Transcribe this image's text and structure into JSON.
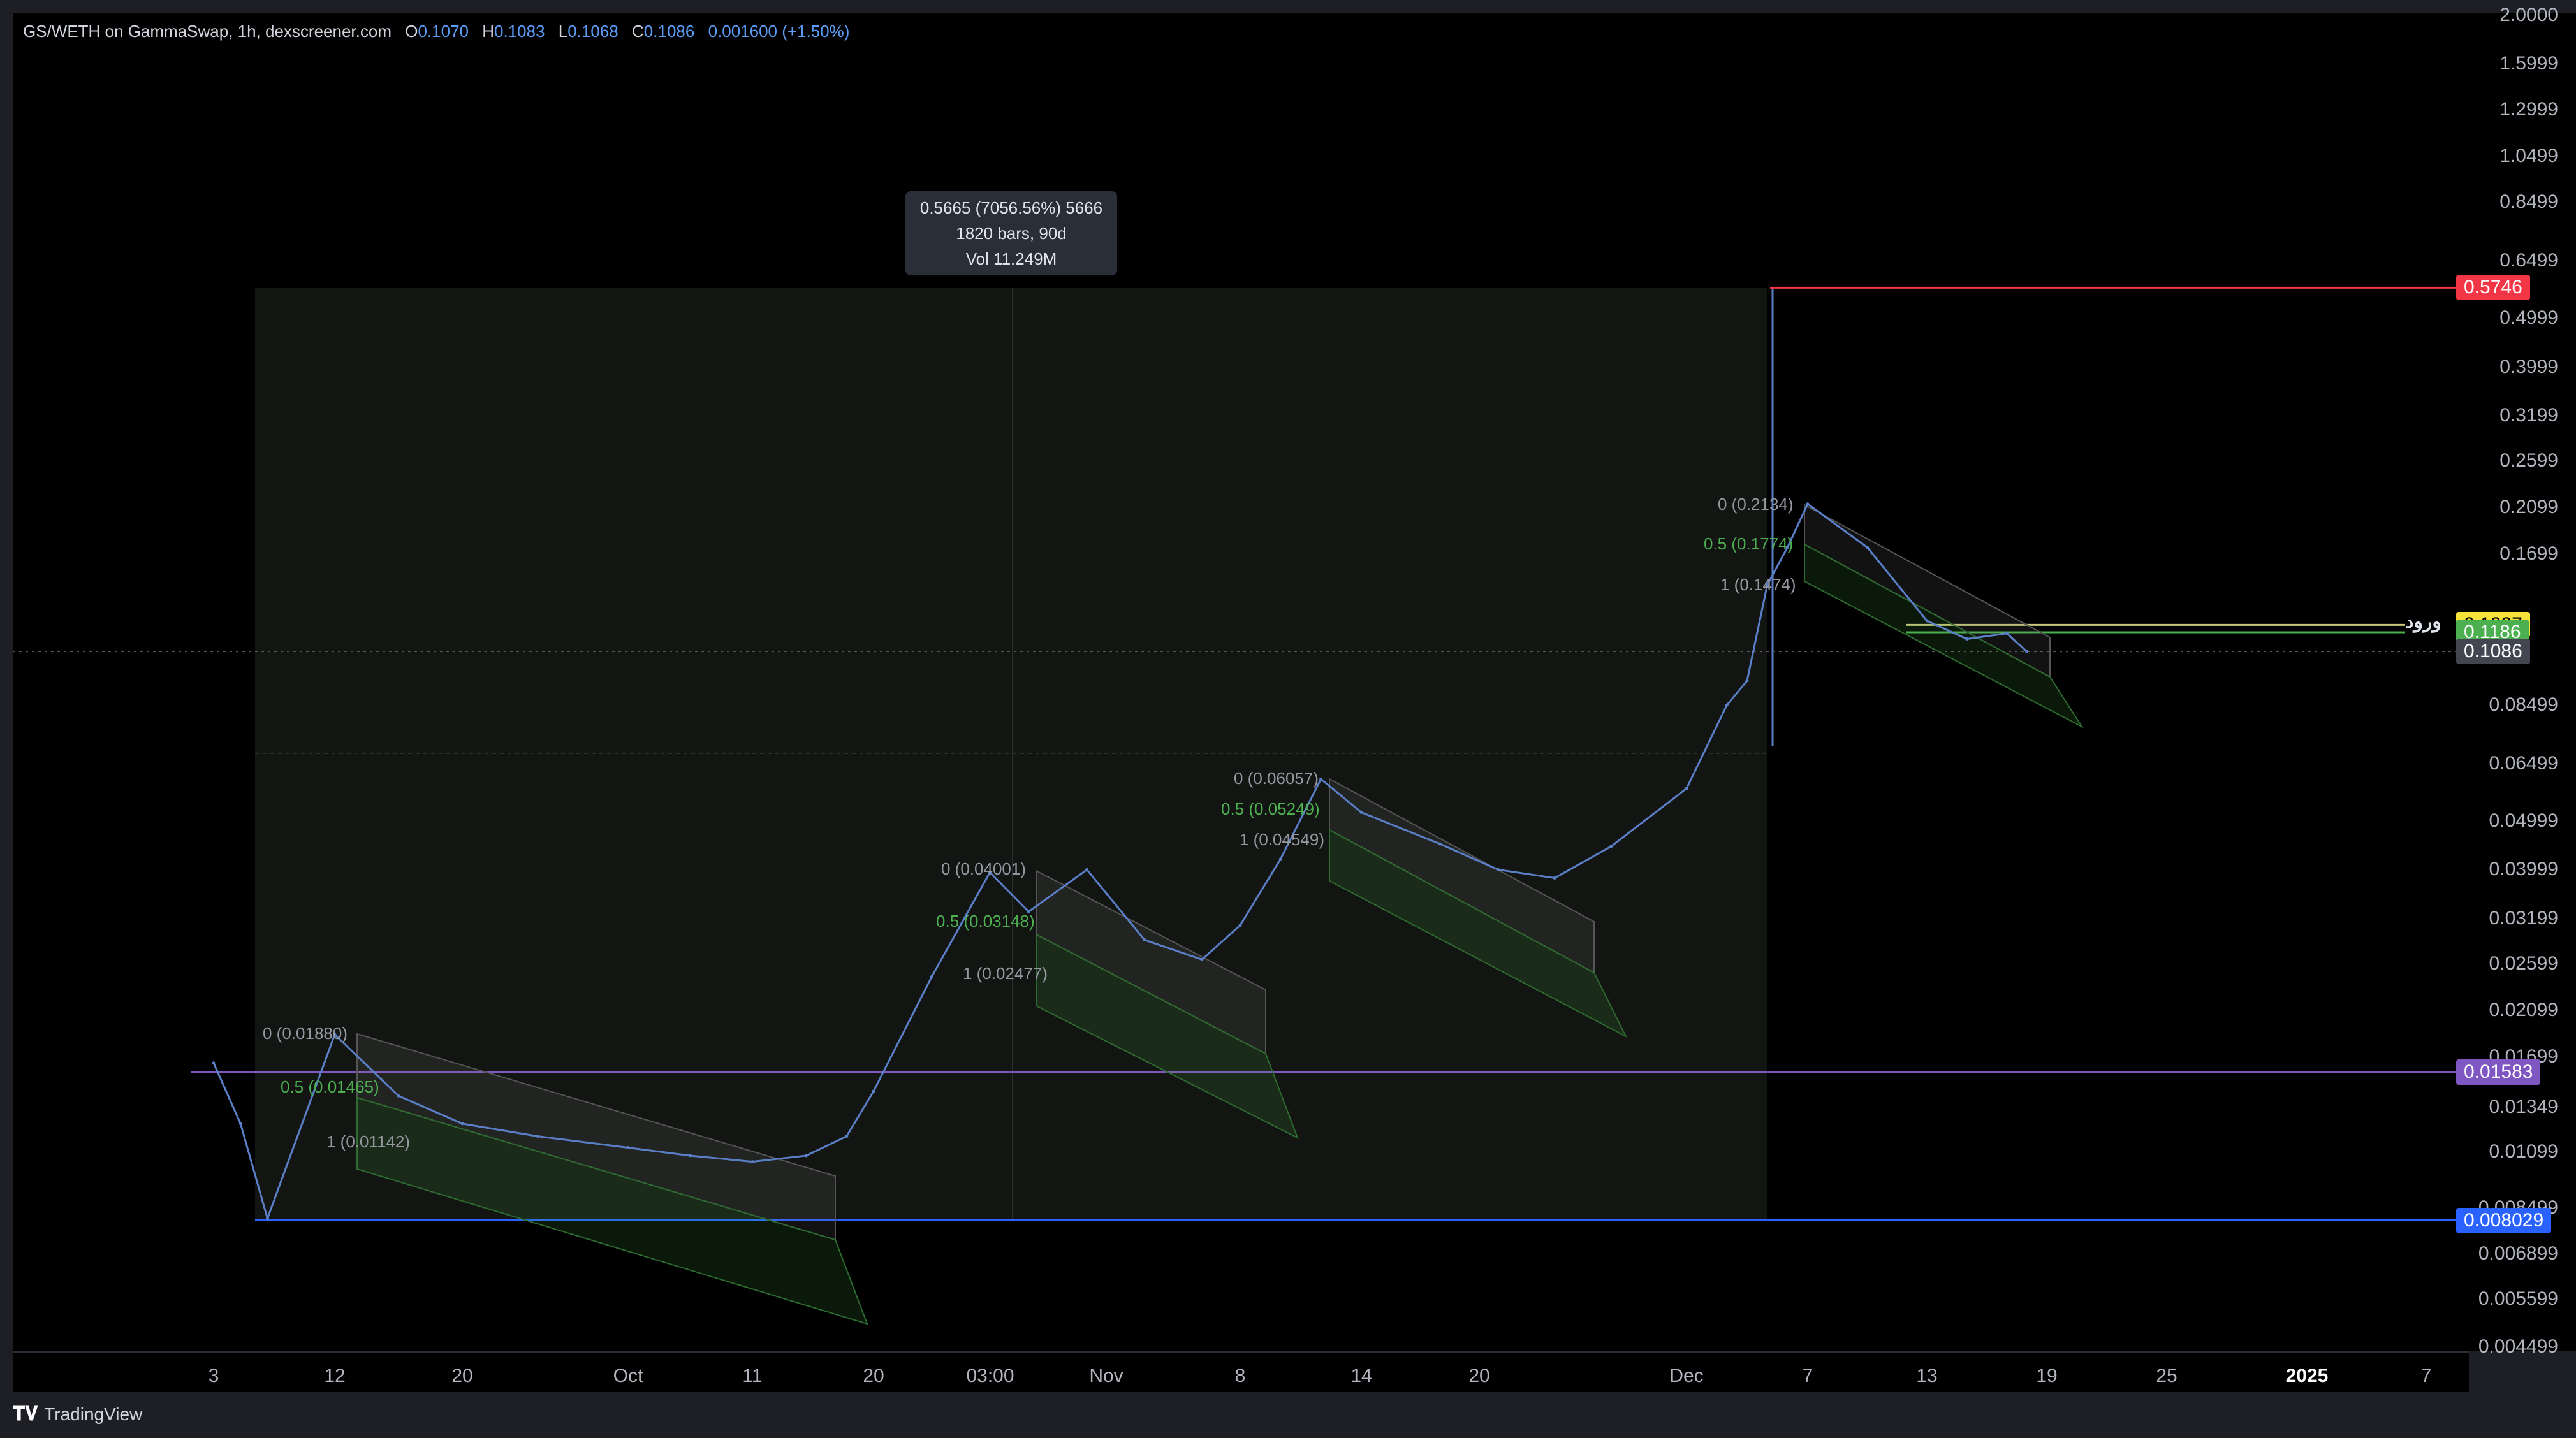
{
  "header": {
    "symbol": "GS/WETH on GammaSwap, 1h, dexscreener.com",
    "o_label": "O",
    "o_value": "0.1070",
    "h_label": "H",
    "h_value": "0.1083",
    "l_label": "L",
    "l_value": "0.1068",
    "c_label": "C",
    "c_value": "0.1086",
    "change": "0.001600 (+1.50%)"
  },
  "measure": {
    "line1": "0.5665 (7056.56%) 5666",
    "line2": "1820 bars, 90d",
    "line3": "Vol 11.249M"
  },
  "price_labels": [
    "2.0000",
    "1.5999",
    "1.2999",
    "1.0499",
    "0.8499",
    "0.6499",
    "0.4999",
    "0.3999",
    "0.3199",
    "0.2599",
    "0.2099",
    "0.1699",
    "0.08499",
    "0.06499",
    "0.04999",
    "0.03999",
    "0.03199",
    "0.02599",
    "0.02099",
    "0.01699",
    "0.01349",
    "0.01099",
    "0.008499",
    "0.006899",
    "0.005599",
    "0.004499"
  ],
  "price_tags": [
    {
      "text": "0.5746",
      "color": "#f23645"
    },
    {
      "text": "0.1227",
      "color": "#f5e33a"
    },
    {
      "text": "0.1186",
      "color": "#4caf50"
    },
    {
      "text": "0.1086",
      "color": "#434651"
    },
    {
      "text": "0.01583",
      "color": "#7e57c2"
    },
    {
      "text": "0.008029",
      "color": "#2962ff"
    }
  ],
  "time_labels": [
    "3",
    "12",
    "20",
    "Oct",
    "11",
    "20",
    "03:00",
    "Nov",
    "8",
    "14",
    "20",
    "Dec",
    "7",
    "13",
    "19",
    "25",
    "2025",
    "7"
  ],
  "fib_labels": [
    {
      "text": "0 (0.01880)",
      "kind": "w"
    },
    {
      "text": "0.5 (0.01465)",
      "kind": "g"
    },
    {
      "text": "1 (0.01142)",
      "kind": "w"
    },
    {
      "text": "0 (0.04001)",
      "kind": "w"
    },
    {
      "text": "0.5 (0.03148)",
      "kind": "g"
    },
    {
      "text": "1 (0.02477)",
      "kind": "w"
    },
    {
      "text": "0 (0.06057)",
      "kind": "w"
    },
    {
      "text": "0.5 (0.05249)",
      "kind": "g"
    },
    {
      "text": "1 (0.04549)",
      "kind": "w"
    },
    {
      "text": "0 (0.2134)",
      "kind": "w"
    },
    {
      "text": "0.5 (0.1774)",
      "kind": "g"
    },
    {
      "text": "1 (0.1474)",
      "kind": "w"
    }
  ],
  "entry_label": "ورود",
  "footer": {
    "brand": "TradingView"
  },
  "colors": {
    "price_line": "#5b7fc7",
    "resistance": "#f23645",
    "support_purple": "#7e57c2",
    "support_blue": "#2962ff",
    "channel_green": "#4caf50"
  },
  "chart_data": {
    "type": "line",
    "title": "GS/WETH on GammaSwap, 1h, dexscreener.com",
    "y_scale": "log",
    "ylim": [
      0.004499,
      2.0
    ],
    "series": [
      {
        "name": "GS/WETH",
        "x": [
          "Sep 3",
          "Sep 5",
          "Sep 7",
          "Sep 12",
          "Sep 16",
          "Sep 20",
          "Sep 25",
          "Oct 1",
          "Oct 6",
          "Oct 11",
          "Oct 15",
          "Oct 18",
          "Oct 20",
          "Oct 23",
          "Oct 26",
          "Oct 28",
          "Oct 31",
          "Nov 3",
          "Nov 6",
          "Nov 8",
          "Nov 10",
          "Nov 12",
          "Nov 14",
          "Nov 18",
          "Nov 21",
          "Nov 24",
          "Nov 27",
          "Dec 1",
          "Dec 3",
          "Dec 4",
          "Dec 5",
          "Dec 6",
          "Dec 7",
          "Dec 10",
          "Dec 13",
          "Dec 15",
          "Dec 17",
          "Dec 18"
        ],
        "values": [
          0.0165,
          0.0125,
          0.0081,
          0.0188,
          0.0142,
          0.0125,
          0.0118,
          0.0112,
          0.0108,
          0.0105,
          0.0108,
          0.0118,
          0.0145,
          0.0245,
          0.0395,
          0.033,
          0.04,
          0.029,
          0.0265,
          0.031,
          0.042,
          0.06057,
          0.052,
          0.045,
          0.04,
          0.0385,
          0.0445,
          0.058,
          0.085,
          0.095,
          0.1474,
          0.175,
          0.2134,
          0.175,
          0.125,
          0.115,
          0.118,
          0.1086
        ]
      }
    ],
    "horizontal_lines": [
      0.5746,
      0.1227,
      0.1186,
      0.01583,
      0.008029
    ],
    "measure": {
      "change": 0.5665,
      "percent": 7056.56,
      "bars": 1820,
      "days": 90,
      "volume": "11.249M"
    }
  }
}
